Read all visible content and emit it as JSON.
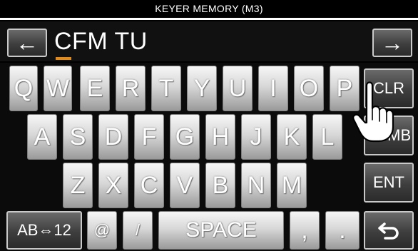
{
  "title": "KEYER MEMORY  (M3)",
  "input": {
    "value": "CFM TU",
    "left_arrow_icon": "left-arrow-icon",
    "right_arrow_icon": "right-arrow-icon"
  },
  "keyboard": {
    "row1": [
      "Q",
      "W",
      "E",
      "R",
      "T",
      "Y",
      "U",
      "I",
      "O",
      "P"
    ],
    "row2": [
      "A",
      "S",
      "D",
      "F",
      "G",
      "H",
      "J",
      "K",
      "L"
    ],
    "row3": [
      "Z",
      "X",
      "C",
      "V",
      "B",
      "N",
      "M"
    ],
    "bottom": {
      "mode": "AB⇔12",
      "at": "@",
      "slash": "/",
      "space": "SPACE",
      "comma": ",",
      "period": "."
    }
  },
  "function_keys": {
    "clear": "CLR",
    "symbol": "SYMB",
    "enter": "ENT",
    "back_icon": "return-icon"
  },
  "colors": {
    "cursor": "#e08a1b",
    "key_face": "#e6e6e6",
    "background": "#000000"
  }
}
